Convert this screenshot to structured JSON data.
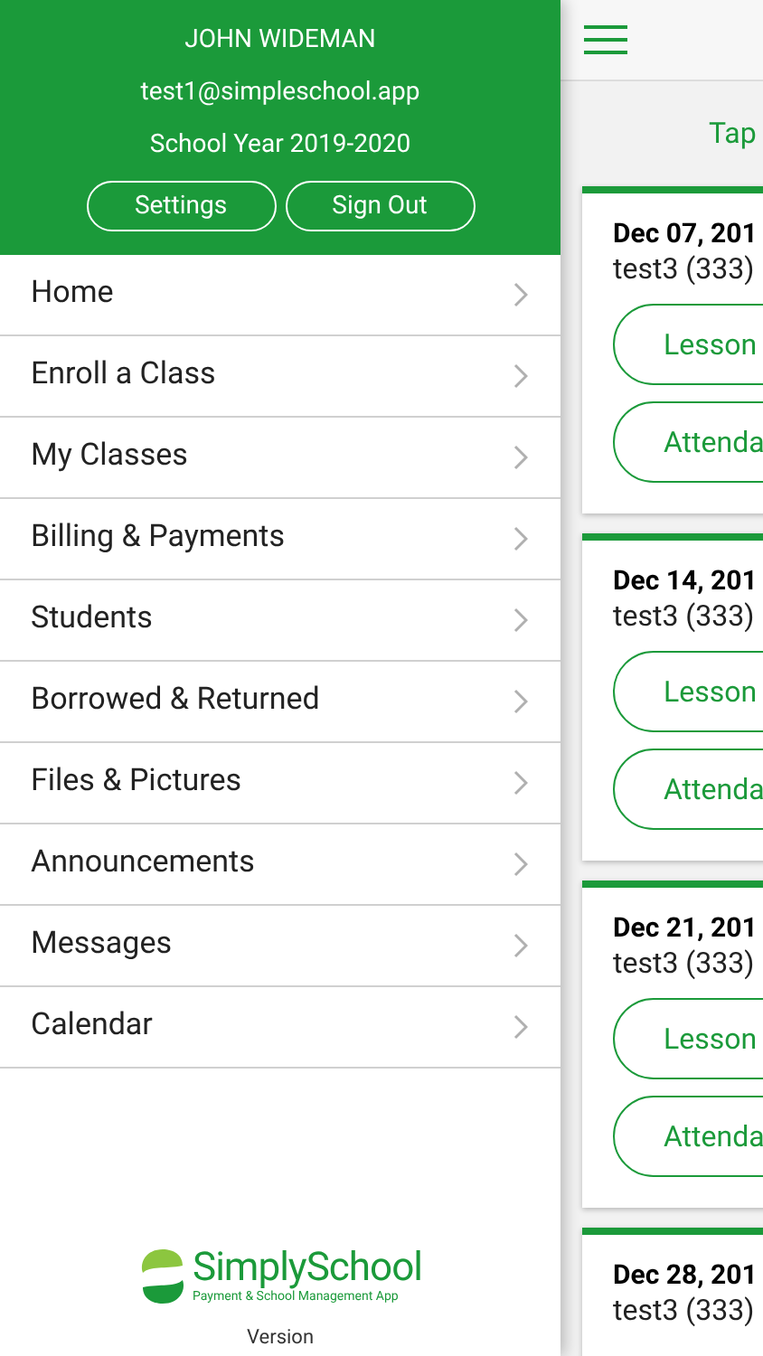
{
  "profile": {
    "name": "JOHN WIDEMAN",
    "email": "test1@simpleschool.app",
    "school_year": "School Year 2019-2020"
  },
  "header_buttons": [
    "Settings",
    "Sign Out"
  ],
  "menu": [
    {
      "label": "Home"
    },
    {
      "label": "Enroll a Class"
    },
    {
      "label": "My Classes"
    },
    {
      "label": "Billing & Payments"
    },
    {
      "label": "Students"
    },
    {
      "label": "Borrowed & Returned"
    },
    {
      "label": "Files & Pictures"
    },
    {
      "label": "Announcements"
    },
    {
      "label": "Messages"
    },
    {
      "label": "Calendar"
    }
  ],
  "logo": {
    "name": "SimplySchool",
    "tagline": "Payment & School Management App"
  },
  "version": "Version",
  "hint": "Tap",
  "cards": [
    {
      "date": "Dec 07, 201",
      "student": "test3 (333)",
      "buttons": [
        "Lesson",
        "Attenda"
      ]
    },
    {
      "date": "Dec 14, 201",
      "student": "test3 (333)",
      "buttons": [
        "Lesson",
        "Attenda"
      ]
    },
    {
      "date": "Dec 21, 201",
      "student": "test3 (333)",
      "buttons": [
        "Lesson",
        "Attenda"
      ]
    },
    {
      "date": "Dec 28, 201",
      "student": "test3 (333)"
    }
  ]
}
